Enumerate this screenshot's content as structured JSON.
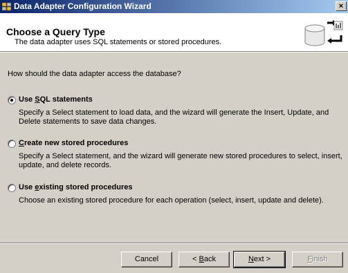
{
  "window": {
    "title": "Data Adapter Configuration Wizard",
    "close_label": "×"
  },
  "header": {
    "heading": "Choose a Query Type",
    "subheading": "The data adapter uses SQL statements or stored procedures."
  },
  "question": "How should the data adapter access the database?",
  "options": [
    {
      "pre": "Use ",
      "accel": "S",
      "post": "QL statements",
      "selected": true,
      "description": "Specify a Select statement to load data, and the wizard will generate the Insert, Update, and Delete statements to save data changes."
    },
    {
      "pre": "",
      "accel": "C",
      "post": "reate new stored procedures",
      "selected": false,
      "description": "Specify a Select statement, and the wizard will generate new stored procedures to select, insert, update, and delete records."
    },
    {
      "pre": "Use ",
      "accel": "e",
      "post": "xisting stored procedures",
      "selected": false,
      "description": "Choose an existing stored procedure for each operation (select, insert, update and delete)."
    }
  ],
  "buttons": {
    "cancel": {
      "label": "Cancel"
    },
    "back": {
      "pre": "< ",
      "accel": "B",
      "post": "ack"
    },
    "next": {
      "pre": "",
      "accel": "N",
      "post": "ext >"
    },
    "finish": {
      "pre": "",
      "accel": "F",
      "post": "inish",
      "enabled": false
    }
  }
}
